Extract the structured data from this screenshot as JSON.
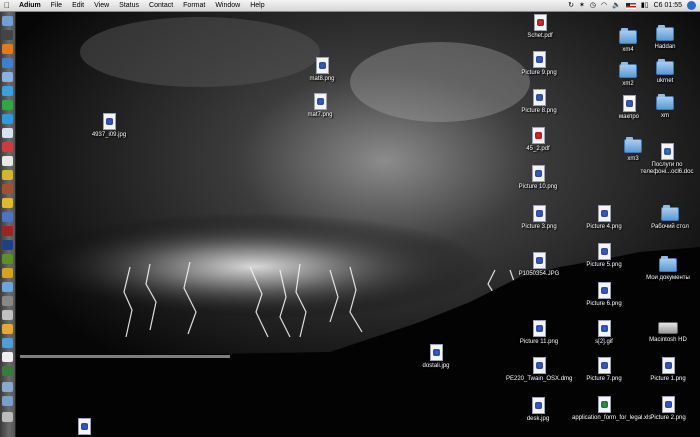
{
  "menubar": {
    "app_name": "Adium",
    "menus": [
      "File",
      "Edit",
      "View",
      "Status",
      "Contact",
      "Format",
      "Window",
      "Help"
    ],
    "clock": "C6 01:55"
  },
  "desktop_icons": [
    {
      "name": "schet-pdf",
      "label": "Schet.pdf",
      "kind": "pdf"
    },
    {
      "name": "picture-9",
      "label": "Picture 9.png",
      "kind": "png"
    },
    {
      "name": "picture-8",
      "label": "Picture 8.png",
      "kind": "png"
    },
    {
      "name": "45-2-pdf",
      "label": "45_2.pdf",
      "kind": "pdf"
    },
    {
      "name": "picture-10",
      "label": "Picture 10.png",
      "kind": "png"
    },
    {
      "name": "picture-3",
      "label": "Picture 3.png",
      "kind": "png"
    },
    {
      "name": "p1050354",
      "label": "P1050354.JPG",
      "kind": "png"
    },
    {
      "name": "picture-11",
      "label": "Picture 11.png",
      "kind": "png"
    },
    {
      "name": "pe220",
      "label": "PE220_Twain_OSX.dmg",
      "kind": "png"
    },
    {
      "name": "desk-jpg",
      "label": "desk.jpg",
      "kind": "png"
    },
    {
      "name": "mat8",
      "label": "mat8.png",
      "kind": "png"
    },
    {
      "name": "mat7",
      "label": "mat7.png",
      "kind": "png"
    },
    {
      "name": "4937",
      "label": "4937_i09.jpg",
      "kind": "png"
    },
    {
      "name": "dostali",
      "label": "dostali.jpg",
      "kind": "png"
    },
    {
      "name": "picture-4",
      "label": "Picture 4.png",
      "kind": "png"
    },
    {
      "name": "picture-5",
      "label": "Picture 5.png",
      "kind": "png"
    },
    {
      "name": "picture-6",
      "label": "Picture 6.png",
      "kind": "png"
    },
    {
      "name": "s2-gif",
      "label": "s[2].gif",
      "kind": "png"
    },
    {
      "name": "picture-7",
      "label": "Picture 7.png",
      "kind": "png"
    },
    {
      "name": "application-form",
      "label": "application_form_for_legal.xls",
      "kind": "xls"
    },
    {
      "name": "picture-1",
      "label": "Picture 1.png",
      "kind": "png"
    },
    {
      "name": "picture-2",
      "label": "Picture 2.png",
      "kind": "png"
    },
    {
      "name": "poslugi",
      "label": "Послуги по телефоні...ocl6.doc",
      "kind": "doc"
    }
  ],
  "folders": [
    {
      "name": "xm4",
      "label": "xm4"
    },
    {
      "name": "haddan",
      "label": "Haddan"
    },
    {
      "name": "xm2",
      "label": "xm2"
    },
    {
      "name": "ukrnet",
      "label": "ukrnet"
    },
    {
      "name": "makpro",
      "label": "макпро"
    },
    {
      "name": "xm",
      "label": "xm"
    },
    {
      "name": "xm3",
      "label": "xm3"
    },
    {
      "name": "rabochiy-stol",
      "label": "Рабочий стол"
    },
    {
      "name": "moi-dokumenty",
      "label": "Мои документы"
    }
  ],
  "drive": {
    "label": "Macintosh HD"
  }
}
